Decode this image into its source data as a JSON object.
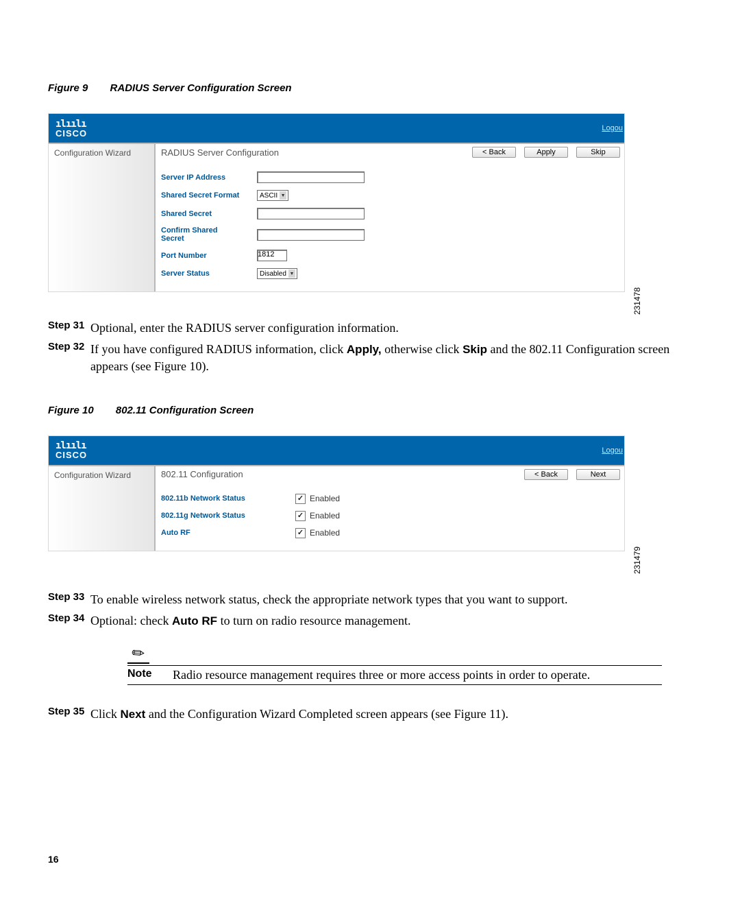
{
  "figure9": {
    "number": "Figure 9",
    "title": "RADIUS Server Configuration Screen",
    "img_id": "231478",
    "logo_text": "CISCO",
    "logo_bars": "ılıılı",
    "logout": "Logou",
    "side_label": "Configuration Wizard",
    "panel_title": "RADIUS Server Configuration",
    "buttons": {
      "back": "< Back",
      "apply": "Apply",
      "skip": "Skip"
    },
    "fields": {
      "ip_label": "Server IP Address",
      "ssf_label": "Shared Secret Format",
      "ssf_value": "ASCII",
      "secret_label": "Shared Secret",
      "confirm_label_line1": "Confirm Shared",
      "confirm_label_line2": "Secret",
      "port_label": "Port Number",
      "port_value": "1812",
      "status_label": "Server Status",
      "status_value": "Disabled"
    }
  },
  "step31": {
    "label": "Step 31",
    "text": "Optional, enter the RADIUS server configuration information."
  },
  "step32": {
    "label": "Step 32",
    "text_a": "If you have configured RADIUS information, click ",
    "apply": "Apply,",
    "text_b": " otherwise click ",
    "skip": "Skip",
    "text_c": " and the 802.11 Configuration screen appears (see Figure 10)."
  },
  "figure10": {
    "number": "Figure 10",
    "title": "802.11 Configuration Screen",
    "img_id": "231479",
    "logo_text": "CISCO",
    "logo_bars": "ılıılı",
    "logout": "Logou",
    "side_label": "Configuration Wizard",
    "panel_title": "802.11 Configuration",
    "buttons": {
      "back": "< Back",
      "next": "Next"
    },
    "fields": {
      "b_label": "802.11b Network Status",
      "g_label": "802.11g Network Status",
      "rf_label": "Auto RF",
      "enabled": "Enabled",
      "checked": "✓"
    }
  },
  "step33": {
    "label": "Step 33",
    "text": "To enable wireless network status, check the appropriate network types that you want to support."
  },
  "step34": {
    "label": "Step 34",
    "text_a": "Optional: check ",
    "auto": "Auto RF",
    "text_b": " to turn on radio resource management."
  },
  "note": {
    "label": "Note",
    "text": "Radio resource management requires three or more access points in order to operate."
  },
  "step35": {
    "label": "Step 35",
    "text_a": "Click ",
    "next": "Next",
    "text_b": " and the Configuration Wizard Completed screen appears (see Figure 11)."
  },
  "page_number": "16"
}
